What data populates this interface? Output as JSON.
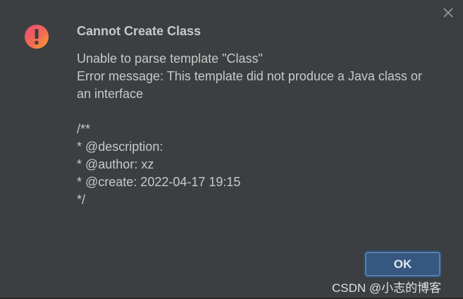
{
  "dialog": {
    "title": "Cannot Create Class",
    "lines": [
      "Unable to parse template \"Class\"",
      "Error message: This template did not produce a Java class or",
      "an interface",
      "",
      "/**",
      "* @description:",
      "* @author: xz",
      "* @create: 2022-04-17 19:15",
      "*/"
    ],
    "ok_label": "OK",
    "icon": "error-exclamation-icon",
    "close_icon": "close-icon"
  },
  "watermark": {
    "text": "CSDN @小志的博客"
  },
  "colors": {
    "background": "#3c3f41",
    "text": "#c8c8c8",
    "button": "#365880",
    "icon_gradient_top": "#f0585f",
    "icon_gradient_bottom": "#f5a623"
  }
}
